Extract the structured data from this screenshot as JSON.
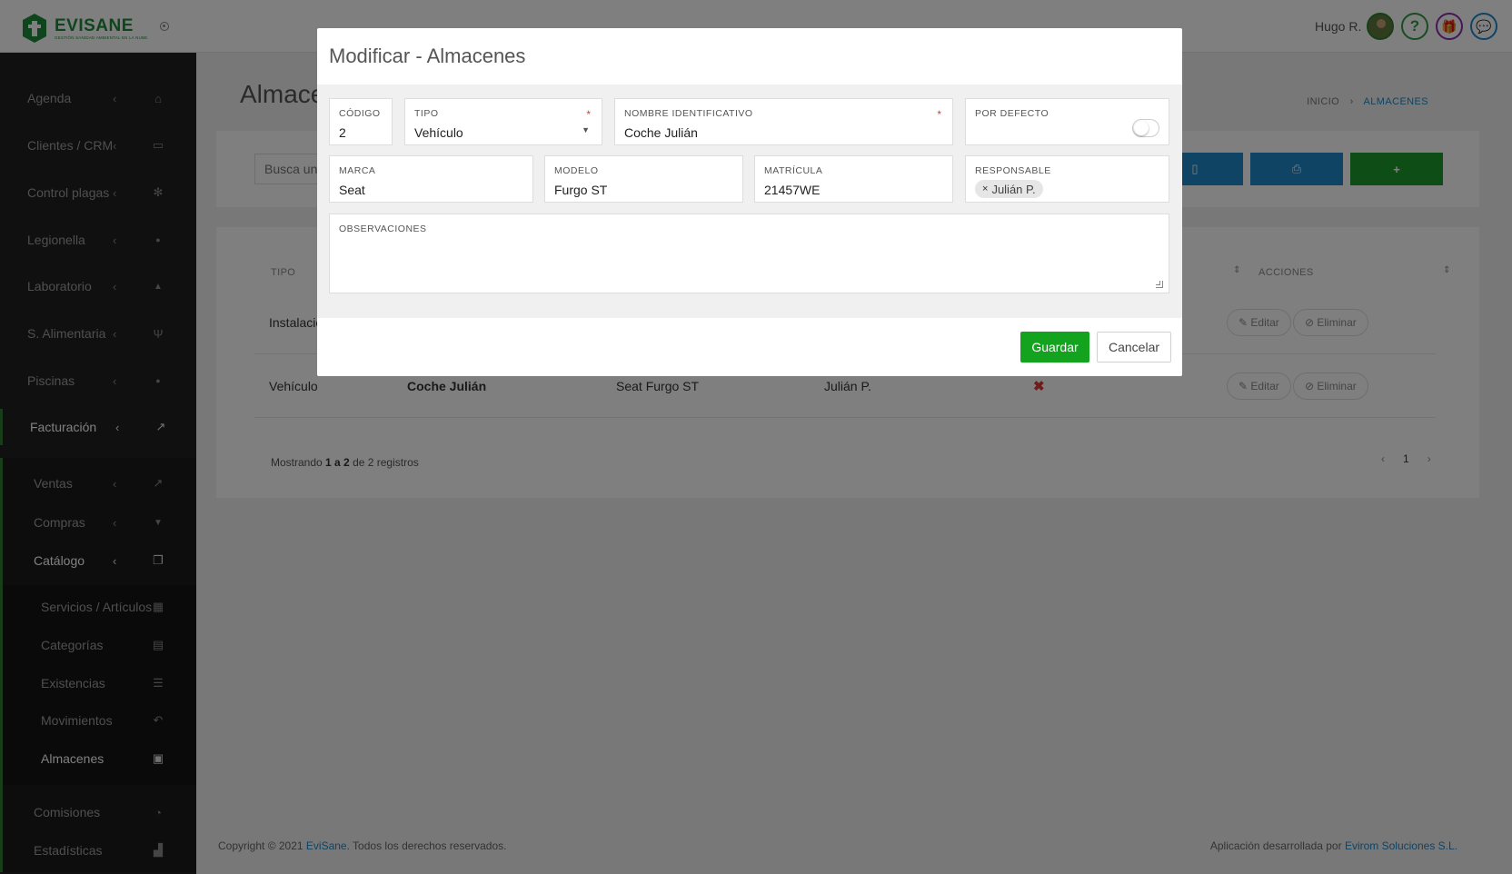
{
  "app": {
    "name": "EVISANE",
    "tagline": "GESTIÓN SANIDAD AMBIENTAL EN LA NUBE",
    "accent": "#1d8b3a"
  },
  "header": {
    "user_name": "Hugo R.",
    "help_glyph": "?",
    "gift_glyph": "🎁",
    "chat_glyph": "💬"
  },
  "sidebar": {
    "items": [
      {
        "label": "Agenda",
        "icon": "home-icon",
        "glyph": "⌂"
      },
      {
        "label": "Clientes / CRM",
        "icon": "id-card-icon",
        "glyph": "▭"
      },
      {
        "label": "Control plagas",
        "icon": "bug-icon",
        "glyph": "✻"
      },
      {
        "label": "Legionella",
        "icon": "drop-icon",
        "glyph": "●"
      },
      {
        "label": "Laboratorio",
        "icon": "flask-icon",
        "glyph": "▲"
      },
      {
        "label": "S. Alimentaria",
        "icon": "cutlery-icon",
        "glyph": "Ψ"
      },
      {
        "label": "Piscinas",
        "icon": "drop-icon",
        "glyph": "●"
      },
      {
        "label": "Facturación",
        "icon": "line-chart-icon",
        "glyph": "↗"
      }
    ],
    "facturacion_sub": [
      {
        "label": "Ventas",
        "icon": "line-chart-icon",
        "glyph": "↗"
      },
      {
        "label": "Compras",
        "icon": "cart-icon",
        "glyph": "▼"
      },
      {
        "label": "Catálogo",
        "icon": "copy-icon",
        "glyph": "❐"
      }
    ],
    "catalogo_sub": [
      {
        "label": "Servicios / Artículos",
        "icon": "cubes-icon",
        "glyph": "▦"
      },
      {
        "label": "Categorías",
        "icon": "archive-icon",
        "glyph": "▤"
      },
      {
        "label": "Existencias",
        "icon": "list-icon",
        "glyph": "☰"
      },
      {
        "label": "Movimientos",
        "icon": "reply-icon",
        "glyph": "↶"
      },
      {
        "label": "Almacenes",
        "icon": "inbox-icon",
        "glyph": "▣"
      }
    ],
    "bottom": [
      {
        "label": "Comisiones",
        "icon": "pie-chart-icon",
        "glyph": "◔"
      },
      {
        "label": "Estadísticas",
        "icon": "area-chart-icon",
        "glyph": "▟"
      }
    ]
  },
  "page": {
    "title": "Almacenes",
    "breadcrumb": {
      "home": "INICIO",
      "current": "ALMACENES"
    },
    "search_placeholder": "Busca un almacén",
    "toolbar": {
      "pdf_glyph": "▯",
      "print_glyph": "⎙",
      "add_glyph": "+"
    },
    "table": {
      "headers": {
        "tipo": "TIPO",
        "acciones": "ACCIONES"
      },
      "rows": [
        {
          "tipo": "Instalación",
          "nombre": "",
          "marca_modelo": "",
          "responsable": "",
          "defecto": ""
        },
        {
          "tipo": "Vehículo",
          "nombre": "Coche Julián",
          "marca_modelo": "Seat Furgo ST",
          "responsable": "Julián P.",
          "defecto": "✖"
        }
      ],
      "edit_label": "Editar",
      "delete_label": "Eliminar",
      "info": {
        "prefix": "Mostrando ",
        "range": "1 a 2",
        "suffix": " de 2 registros"
      },
      "pager": {
        "prev": "‹",
        "page": "1",
        "next": "›"
      }
    },
    "footer": {
      "copyright_prefix": "Copyright © 2021 ",
      "brand": "EviSane",
      "copyright_suffix": ". Todos los derechos reservados.",
      "dev_prefix": "Aplicación desarrollada por ",
      "dev_brand": "Evirom Soluciones S.L."
    }
  },
  "modal": {
    "title": "Modificar - Almacenes",
    "fields": {
      "codigo": {
        "label": "CÓDIGO",
        "value": "2"
      },
      "tipo": {
        "label": "TIPO",
        "value": "Vehículo"
      },
      "nombre": {
        "label": "NOMBRE IDENTIFICATIVO",
        "value": "Coche Julián"
      },
      "por_defecto": {
        "label": "POR DEFECTO",
        "value": false
      },
      "marca": {
        "label": "MARCA",
        "value": "Seat"
      },
      "modelo": {
        "label": "MODELO",
        "value": "Furgo ST"
      },
      "matricula": {
        "label": "MATRÍCULA",
        "value": "21457WE"
      },
      "responsable": {
        "label": "RESPONSABLE",
        "value": "Julián P."
      },
      "observaciones": {
        "label": "OBSERVACIONES",
        "value": ""
      }
    },
    "required_mark": "*",
    "save_label": "Guardar",
    "cancel_label": "Cancelar",
    "colors": {
      "save": "#13a31f",
      "required": "#e53935"
    }
  }
}
